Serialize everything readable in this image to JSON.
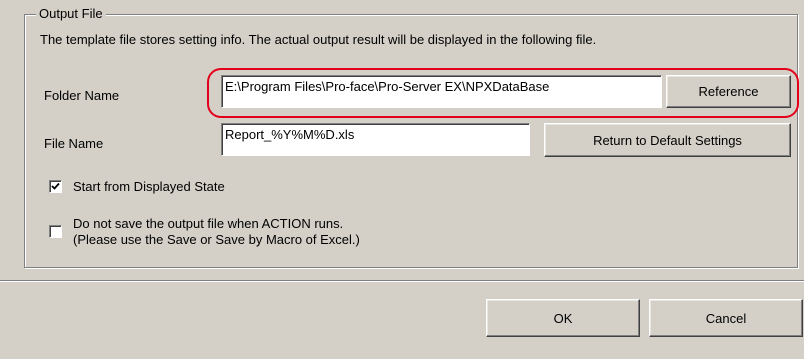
{
  "group": {
    "title": "Output File",
    "description": "The template file stores setting info. The actual output result will be displayed in the following file."
  },
  "folder": {
    "label": "Folder Name",
    "value": "E:\\Program Files\\Pro-face\\Pro-Server EX\\NPXDataBase",
    "button_label": "Reference"
  },
  "file": {
    "label": "File Name",
    "value": "Report_%Y%M%D.xls",
    "button_label": "Return to Default Settings"
  },
  "options": {
    "start_displayed": {
      "label": "Start from Displayed State",
      "checked": true
    },
    "no_save": {
      "label_line1": "Do not save the output file when ACTION runs.",
      "label_line2": "(Please use the Save or Save by Macro of Excel.)",
      "checked": false
    }
  },
  "footer": {
    "ok_label": "OK",
    "cancel_label": "Cancel"
  },
  "colors": {
    "dialog_bg": "#d4d0c8",
    "highlight": "#e4001b"
  }
}
